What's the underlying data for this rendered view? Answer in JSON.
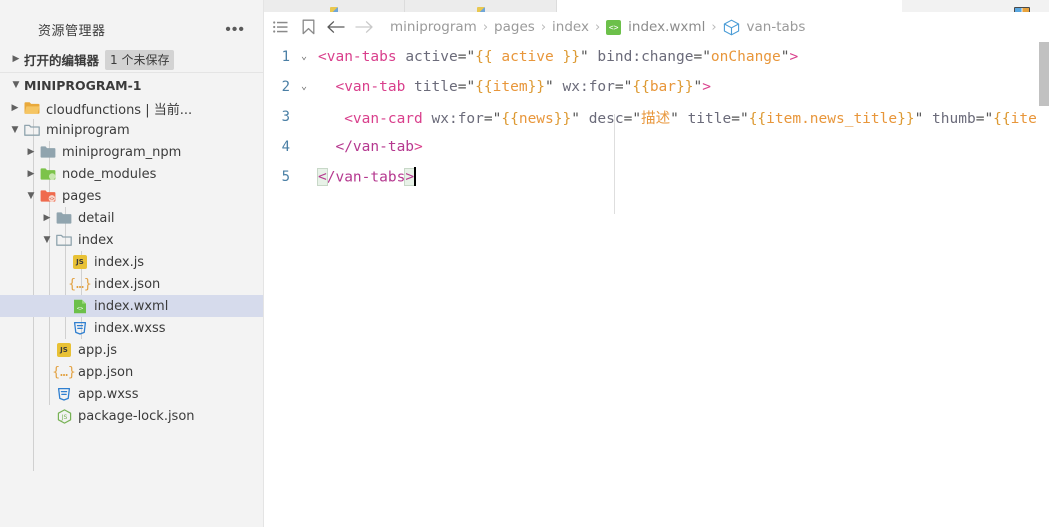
{
  "sidebar": {
    "title": "资源管理器",
    "more_icon": "ellipsis-icon",
    "open_editors": {
      "label": "打开的编辑器",
      "badge": "1 个未保存",
      "twisty": "▶"
    },
    "project": {
      "label": "MINIPROGRAM-1",
      "twisty": "▼"
    },
    "tree": [
      {
        "label": "cloudfunctions | 当前...",
        "arrow": "▶",
        "icon": "folder-open-yellow-icon",
        "depth": 1,
        "selected": false
      },
      {
        "label": "miniprogram",
        "arrow": "▼",
        "icon": "folder-gray-icon",
        "depth": 1,
        "selected": false
      },
      {
        "label": "miniprogram_npm",
        "arrow": "▶",
        "icon": "folder-closed-gray-icon",
        "depth": 2,
        "selected": false
      },
      {
        "label": "node_modules",
        "arrow": "▶",
        "icon": "folder-node-green-icon",
        "depth": 2,
        "selected": false
      },
      {
        "label": "pages",
        "arrow": "▼",
        "icon": "folder-pages-red-icon",
        "depth": 2,
        "selected": false
      },
      {
        "label": "detail",
        "arrow": "▶",
        "icon": "folder-closed-gray-icon",
        "depth": 3,
        "selected": false
      },
      {
        "label": "index",
        "arrow": "▼",
        "icon": "folder-gray-icon",
        "depth": 3,
        "selected": false
      },
      {
        "label": "index.js",
        "arrow": "",
        "icon": "js-file-icon",
        "depth": 4,
        "selected": false
      },
      {
        "label": "index.json",
        "arrow": "",
        "icon": "json-file-icon",
        "depth": 4,
        "selected": false
      },
      {
        "label": "index.wxml",
        "arrow": "",
        "icon": "wxml-file-icon",
        "depth": 4,
        "selected": true
      },
      {
        "label": "index.wxss",
        "arrow": "",
        "icon": "wxss-file-icon",
        "depth": 4,
        "selected": false
      },
      {
        "label": "app.js",
        "arrow": "",
        "icon": "js-file-icon",
        "depth": 3,
        "selected": false
      },
      {
        "label": "app.json",
        "arrow": "",
        "icon": "json-file-icon",
        "depth": 3,
        "selected": false
      },
      {
        "label": "app.wxss",
        "arrow": "",
        "icon": "wxss-file-icon",
        "depth": 3,
        "selected": false
      },
      {
        "label": "package-lock.json",
        "arrow": "",
        "icon": "node-file-icon",
        "depth": 3,
        "selected": false
      }
    ]
  },
  "editor": {
    "toolbar_icons": [
      "outline-list-icon",
      "bookmark-icon",
      "back-arrow-icon",
      "forward-arrow-icon"
    ],
    "breadcrumb": [
      {
        "label": "miniprogram",
        "icon": ""
      },
      {
        "label": "pages",
        "icon": ""
      },
      {
        "label": "index",
        "icon": ""
      },
      {
        "label": "index.wxml",
        "icon": "wxml-file-icon"
      },
      {
        "label": "van-tabs",
        "icon": "cube-symbol-icon"
      }
    ],
    "breadcrumb_separator": "›",
    "code": {
      "language": "wxml",
      "lines": [
        {
          "num": "1",
          "fold": "⌄",
          "text": "<van-tabs active=\"{{ active }}\" bind:change=\"onChange\">"
        },
        {
          "num": "2",
          "fold": "⌄",
          "text": "  <van-tab title=\"{{item}}\" wx:for=\"{{bar}}\">"
        },
        {
          "num": "3",
          "fold": "",
          "text": "   <van-card wx:for=\"{{news}}\" desc=\"描述\" title=\"{{item.news_title}}\" thumb=\"{{ite"
        },
        {
          "num": "4",
          "fold": "",
          "text": "  </van-tab>"
        },
        {
          "num": "5",
          "fold": "",
          "text": "</van-tabs>"
        }
      ]
    }
  },
  "colors": {
    "tag": "#d93f8c",
    "tag_close": "#b5388f",
    "attribute": "#6b6b7a",
    "string": "#e8963a",
    "mustache": "#e8a33d",
    "line_number": "#4a7fa5",
    "selection": "#d6dbec",
    "sidebar_bg": "#f3f3f3"
  }
}
